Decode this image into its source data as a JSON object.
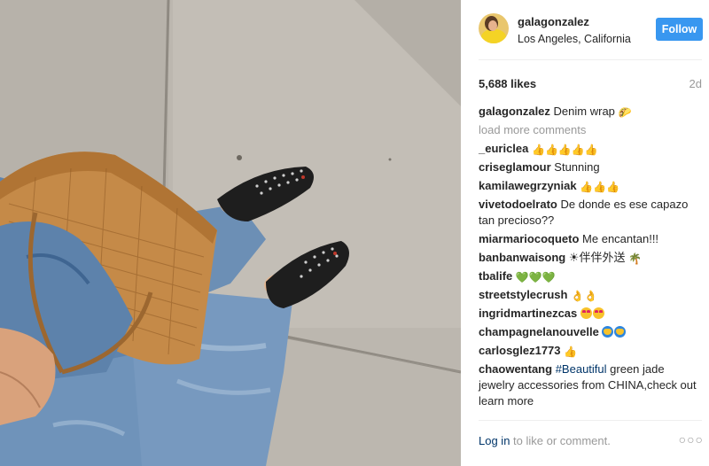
{
  "post": {
    "username": "galagonzalez",
    "location": "Los Angeles, California",
    "follow_label": "Follow",
    "likes": "5,688 likes",
    "age": "2d"
  },
  "caption": {
    "username": "galagonzalez",
    "text": "Denim wrap",
    "emoji": "🌮"
  },
  "load_more": "load more comments",
  "comments": [
    {
      "user": "_euriclea",
      "text": "",
      "emoji": "👍👍👍👍👍"
    },
    {
      "user": "criseglamour",
      "text": "Stunning",
      "emoji": ""
    },
    {
      "user": "kamilawegrzyniak",
      "text": "",
      "emoji": "👍👍👍"
    },
    {
      "user": "vivetodoelrato",
      "text": "De donde es ese capazo tan precioso??",
      "emoji": ""
    },
    {
      "user": "miarmariocoqueto",
      "text": "Me encantan!!!",
      "emoji": ""
    },
    {
      "user": "banbanwaisong",
      "text": "☀伴伴外送",
      "emoji": "🌴"
    },
    {
      "user": "tbalife",
      "text": "",
      "emoji": "💚💚💚"
    },
    {
      "user": "streetstylecrush",
      "text": "",
      "emoji": "👌👌"
    },
    {
      "user": "ingridmartinezcas",
      "text": "",
      "emoji": "😍😍"
    },
    {
      "user": "champagnelanouvelle",
      "text": "",
      "emoji": "🙌🙌"
    },
    {
      "user": "carlosglez1773",
      "text": "",
      "emoji": "👍"
    },
    {
      "user": "chaowentang",
      "hashtag": "#Beautiful",
      "text": "green jade jewelry accessories from CHINA,check out learn more",
      "emoji": ""
    }
  ],
  "footer": {
    "login_link": "Log in",
    "login_rest": "to like or comment.",
    "more_icon": "more-dots-icon"
  },
  "icons": {
    "thumb": "thumbs-up-emoji",
    "heart": "green-heart-emoji",
    "ok": "ok-hand-emoji",
    "heart_eyes": "heart-eyes-emoji",
    "raised_hands": "raised-hands-emoji",
    "taco": "taco-emoji",
    "palm": "palm-tree-emoji"
  },
  "colors": {
    "follow_button": "#3897f0",
    "link": "#003569",
    "muted": "#999999",
    "text": "#262626"
  }
}
